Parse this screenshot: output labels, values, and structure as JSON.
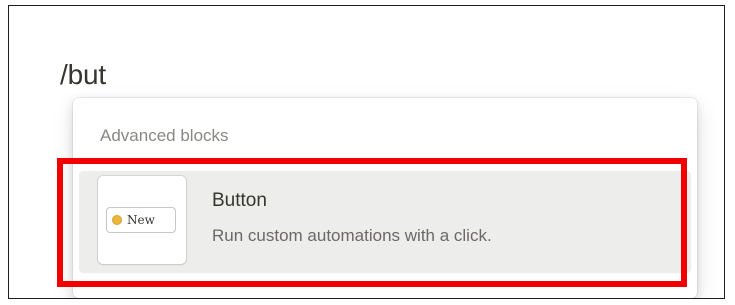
{
  "editor": {
    "slash_command": "/but"
  },
  "menu": {
    "section_header": "Advanced blocks",
    "items": [
      {
        "badge": "New",
        "title": "Button",
        "description": "Run custom automations with a click."
      }
    ]
  },
  "colors": {
    "highlight": "#f20000",
    "selected_item_bg": "#ededeb",
    "badge_dot": "#e8b63a"
  }
}
